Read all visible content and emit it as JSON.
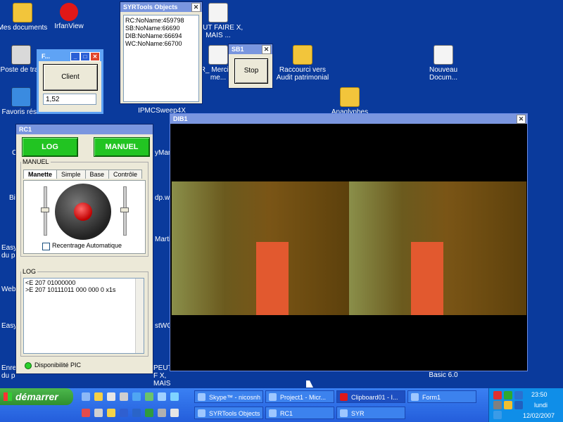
{
  "desktop_icons": [
    {
      "label": "Mes documents",
      "type": "fold"
    },
    {
      "label": "IrfanView",
      "type": "red"
    },
    {
      "label": "Poste de trav",
      "type": "app"
    },
    {
      "label": "Favoris rése",
      "type": "blue"
    },
    {
      "label": "PEUT FAIRE X, MAIS ...",
      "type": "doc"
    },
    {
      "label": "TR_ Merci ton me...",
      "type": "doc"
    },
    {
      "label": "Raccourci vers Audit patrimonial",
      "type": "fold"
    },
    {
      "label": "Nouveau Docum...",
      "type": "doc"
    },
    {
      "label": "Anaglyphes",
      "type": "fold"
    },
    {
      "label": "IPMCSweep4X",
      "type": "app"
    },
    {
      "label": "Basic 6.0",
      "type": "app"
    }
  ],
  "fragments": [
    "C",
    "Bi",
    "Easy-",
    "du p",
    "WebC",
    "Easy",
    "Enre",
    "du p",
    "yMam",
    "dp.w",
    "Marti",
    "stWC",
    "PEUT F X, MAIS ..."
  ],
  "form_small": {
    "title": "F...",
    "client_label": "Client",
    "value": "1,52"
  },
  "syrtools": {
    "title": "SYRTools Objects",
    "lines": [
      "RC:NoName:459798",
      "SB:NoName:66690",
      "DIB:NoName:66694",
      "WC:NoName:66700"
    ]
  },
  "sb1": {
    "title": "SB1",
    "stop_label": "Stop"
  },
  "rc1": {
    "title": "RC1",
    "log_button": "LOG",
    "manuel_button": "MANUEL",
    "group_manuel": "MANUEL",
    "tabs": [
      "Manette",
      "Simple",
      "Base",
      "Contrôle"
    ],
    "recentrage": "Recentrage Automatique",
    "group_log": "LOG",
    "log_lines": [
      "<E 207 01000000",
      ">E 207 10111011 000 000 0 x1s"
    ],
    "status": "Disponibilité PIC"
  },
  "dib1": {
    "title": "DIB1"
  },
  "taskbar": {
    "start_label": "démarrer",
    "row1": [
      "Skype™ - nicosnh",
      "Project1 - Micr...",
      "Clipboard01 - I...",
      "Form1"
    ],
    "row2": [
      "SYRTools Objects",
      "RC1",
      "SYR"
    ],
    "time": "23:50",
    "day": "lundi",
    "date": "12/02/2007"
  },
  "colors": {
    "desktop": "#0a3a9c",
    "title_active": "#1a4fc6",
    "green": "#22c422"
  }
}
